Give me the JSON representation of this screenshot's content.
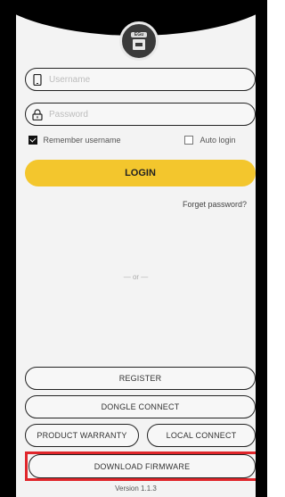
{
  "header": {
    "logo_text": "EGu"
  },
  "login_form": {
    "username_placeholder": "Username",
    "password_placeholder": "Password",
    "remember_label": "Remember username",
    "remember_checked": true,
    "auto_login_label": "Auto login",
    "auto_login_checked": false,
    "login_label": "LOGIN",
    "forget_label": "Forget password?"
  },
  "divider": {
    "or_text": "— or —"
  },
  "actions": {
    "register_label": "REGISTER",
    "dongle_label": "DONGLE CONNECT",
    "warranty_label": "PRODUCT WARRANTY",
    "local_label": "LOCAL CONNECT",
    "download_label": "DOWNLOAD FIRMWARE"
  },
  "footer": {
    "version": "Version 1.1.3"
  },
  "colors": {
    "accent": "#f3c62d",
    "highlight": "#e0262b"
  },
  "icons": {
    "username": "phone-icon",
    "password": "lock-icon"
  }
}
